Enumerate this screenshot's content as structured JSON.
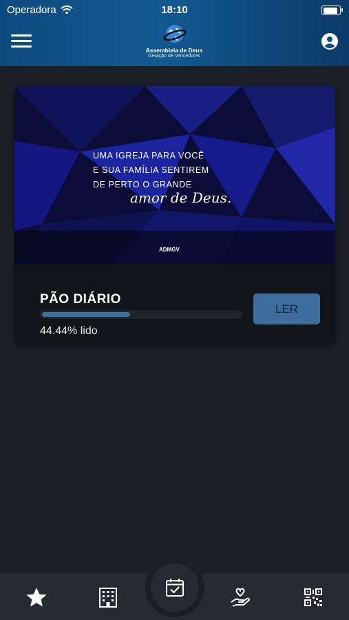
{
  "status_bar": {
    "carrier": "Operadora",
    "time": "18:10"
  },
  "header": {
    "logo_title": "Assembleia de Deus",
    "logo_subtitle": "Geração de Vencedores"
  },
  "banner": {
    "line1": "UMA IGREJA PARA VOCÊ",
    "line2": "E SUA FAMÍLIA SENTIREM",
    "line3": "DE PERTO O GRANDE",
    "script": "amor de Deus.",
    "brand": "ADMGV"
  },
  "card": {
    "title": "PÃO DIÁRIO",
    "progress_percent": 44.44,
    "progress_text": "44.44% lido",
    "button_label": "LER"
  },
  "tabbar": {
    "items": [
      {
        "icon": "star-icon"
      },
      {
        "icon": "building-icon"
      },
      {
        "icon": "calendar-check-icon"
      },
      {
        "icon": "hand-heart-icon"
      },
      {
        "icon": "qr-code-icon"
      }
    ]
  },
  "colors": {
    "header": "#125a92",
    "background": "#1b1f25",
    "accent": "#3e6e9e",
    "card": "#121419",
    "tabbar": "#262b33"
  }
}
